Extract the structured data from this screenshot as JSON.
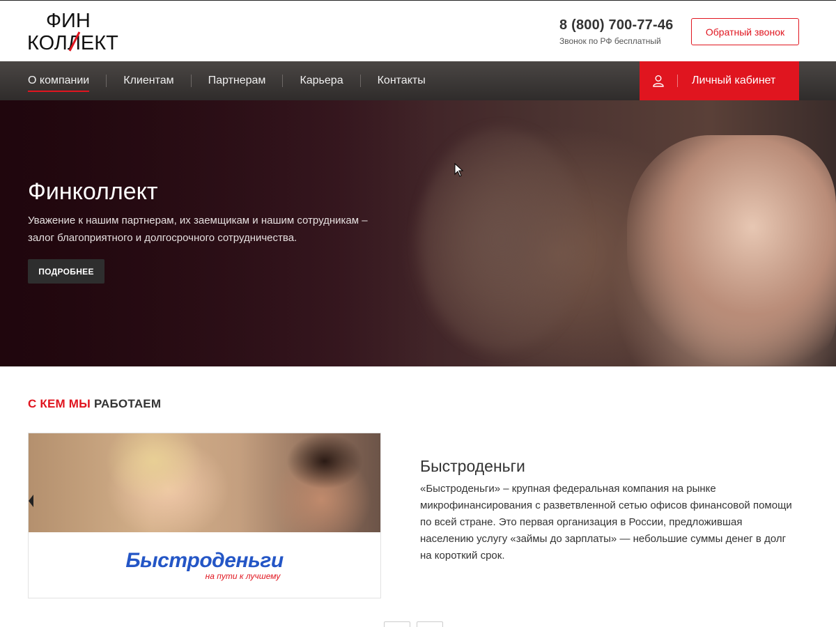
{
  "brand": {
    "logo_top": "ФИН",
    "logo_bottom": "КОЛЛЕКТ"
  },
  "header": {
    "phone": "8 (800) 700-77-46",
    "phone_note": "Звонок по РФ бесплатный",
    "callback_label": "Обратный звонок"
  },
  "nav": {
    "items": [
      {
        "label": "О компании"
      },
      {
        "label": "Клиентам"
      },
      {
        "label": "Партнерам"
      },
      {
        "label": "Карьера"
      },
      {
        "label": "Контакты"
      }
    ],
    "cabinet_label": "Личный кабинет"
  },
  "hero": {
    "title": "Финколлект",
    "text": "Уважение к нашим партнерам, их заемщикам и нашим сотрудникам – залог благоприятного и долгосрочного сотрудничества.",
    "button_label": "ПОДРОБНЕЕ"
  },
  "section": {
    "title_red": "С КЕМ МЫ",
    "title_dark": "РАБОТАЕМ"
  },
  "partner": {
    "logo_main": "Быстроденьги",
    "logo_sub": "на пути к лучшему",
    "name": "Быстроденьги",
    "description": "«Быстроденьги» – крупная федеральная компания на рынке микрофинансирования с разветвленной сетью офисов финансовой помощи по всей стране. Это первая организация в России, предложившая населению услугу «займы до зарплаты» — небольшие суммы денег в долг на короткий срок."
  },
  "colors": {
    "accent": "#e0151f",
    "nav_bg": "#3a3634",
    "partner_blue": "#2456c6"
  },
  "icons": {
    "cabinet": "user-icon",
    "cursor": "mouse-cursor-icon"
  }
}
